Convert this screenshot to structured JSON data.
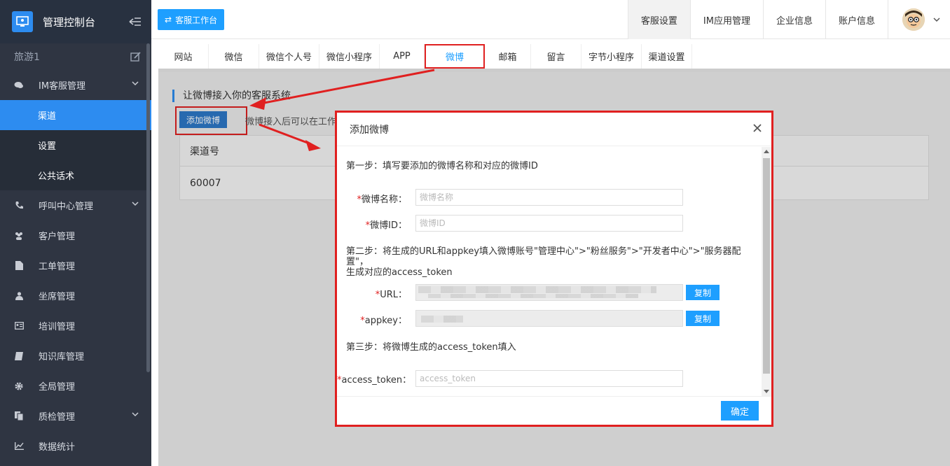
{
  "app": {
    "title": "管理控制台",
    "tenant": "旅游1"
  },
  "sidebar": {
    "items": [
      {
        "label": "IM客服管理",
        "icon": "chat-icon",
        "expanded": true,
        "children": [
          {
            "label": "渠道",
            "active": true
          },
          {
            "label": "设置"
          },
          {
            "label": "公共话术"
          }
        ]
      },
      {
        "label": "呼叫中心管理",
        "icon": "phone-icon",
        "expandable": true
      },
      {
        "label": "客户管理",
        "icon": "users-icon"
      },
      {
        "label": "工单管理",
        "icon": "document-icon"
      },
      {
        "label": "坐席管理",
        "icon": "user-icon"
      },
      {
        "label": "培训管理",
        "icon": "id-card-icon"
      },
      {
        "label": "知识库管理",
        "icon": "book-icon"
      },
      {
        "label": "全局管理",
        "icon": "gear-icon"
      },
      {
        "label": "质检管理",
        "icon": "copy-icon",
        "expandable": true
      },
      {
        "label": "数据统计",
        "icon": "chart-icon"
      }
    ]
  },
  "topbar": {
    "workspace_button": "客服工作台",
    "tabs": [
      "客服设置",
      "IM应用管理",
      "企业信息",
      "账户信息"
    ],
    "active_tab": 0
  },
  "channel_tabs": [
    "网站",
    "微信",
    "微信个人号",
    "微信小程序",
    "APP",
    "微博",
    "邮箱",
    "留言",
    "字节小程序",
    "渠道设置"
  ],
  "active_channel": 5,
  "main": {
    "intro": "让微博接入你的客服系统",
    "add_button": "添加微博",
    "hint": "微博接入后可以在工作台",
    "table": {
      "header": "渠道号",
      "rows": [
        "60007"
      ]
    }
  },
  "modal": {
    "title": "添加微博",
    "step1": "第一步：填写要添加的微博名称和对应的微博ID",
    "fields1": [
      {
        "label": "微博名称：",
        "placeholder": "微博名称"
      },
      {
        "label": "微博ID：",
        "placeholder": "微博ID"
      }
    ],
    "step2_line1": "第二步：将生成的URL和appkey填入微博账号\"管理中心\">\"粉丝服务\">\"开发者中心\">\"服务器配置\"，",
    "step2_line2": "生成对应的access_token",
    "url_label": "URL：",
    "appkey_label": "appkey：",
    "copy_label": "复制",
    "step3": "第三步：将微博生成的access_token填入",
    "token_label": "access_token：",
    "token_placeholder": "access_token",
    "ok_label": "确定"
  },
  "colors": {
    "sidebar_bg": "#2f3542",
    "accent": "#1e9fff",
    "highlight": "#e02020"
  }
}
